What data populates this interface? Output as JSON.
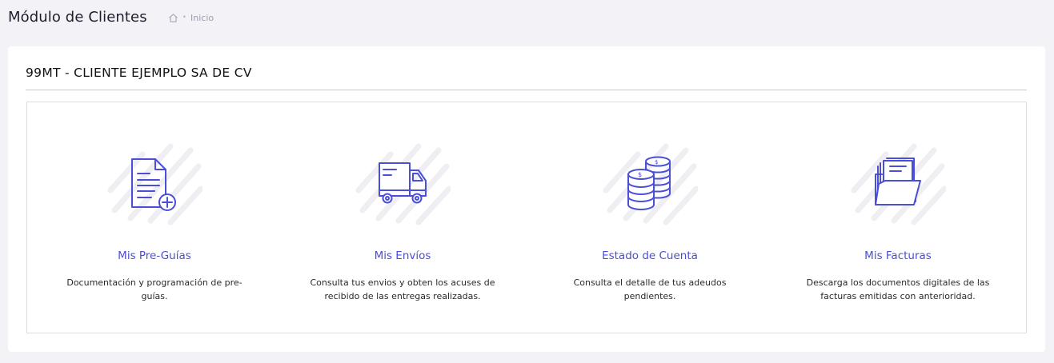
{
  "header": {
    "title": "Módulo de Clientes",
    "breadcrumb": {
      "home_icon": "home-icon",
      "separator": "•",
      "current": "Inicio"
    }
  },
  "card": {
    "title": "99MT - CLIENTE EJEMPLO SA DE CV"
  },
  "modules": [
    {
      "icon": "document-add-icon",
      "title": "Mis Pre-Guías",
      "description": "Documentación y programación de pre-guías."
    },
    {
      "icon": "truck-icon",
      "title": "Mis Envíos",
      "description": "Consulta tus envios y obten los acuses de recibido de las entregas realizadas."
    },
    {
      "icon": "coins-icon",
      "title": "Estado de Cuenta",
      "description": "Consulta el detalle de tus adeudos pendientes."
    },
    {
      "icon": "folder-documents-icon",
      "title": "Mis Facturas",
      "description": "Descarga los documentos digitales de las facturas emitidas con anterioridad."
    }
  ],
  "colors": {
    "accent": "#4b4ed2",
    "icon_stroke": "#4a4fd6",
    "background": "#f3f3f7",
    "card": "#ffffff"
  }
}
